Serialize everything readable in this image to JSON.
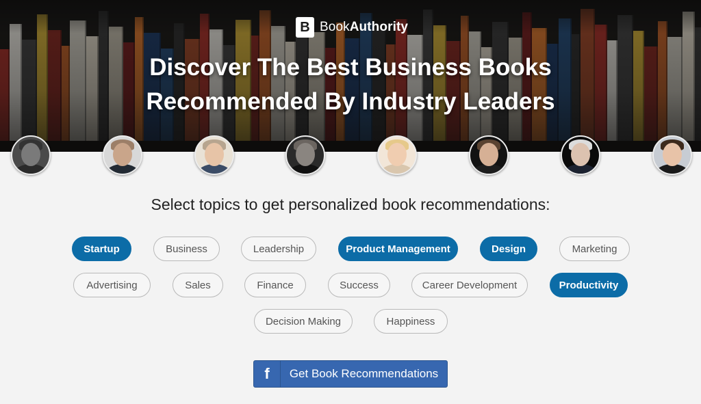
{
  "header": {
    "logo_letter": "B",
    "logo_text_prefix": "Book",
    "logo_text_suffix": "Authority",
    "headline_line1": "Discover The Best Business Books",
    "headline_line2": "Recommended By Industry Leaders"
  },
  "leaders": [
    {
      "skin": "#7a7a7a",
      "hair": "#333333",
      "shirt": "#2a2a2a",
      "bg": "#4a4a4a"
    },
    {
      "skin": "#c9a58a",
      "hair": "#9c7f68",
      "shirt": "#222a33",
      "bg": "#d8d8d8"
    },
    {
      "skin": "#e7c4a7",
      "hair": "#b7a58f",
      "shirt": "#3b4c66",
      "bg": "#e9e2d6"
    },
    {
      "skin": "#8a8580",
      "hair": "#6b6560",
      "shirt": "#111111",
      "bg": "#2a2a2a"
    },
    {
      "skin": "#f0cdb0",
      "hair": "#e6c98a",
      "shirt": "#d9c6ad",
      "bg": "#f2e6d8"
    },
    {
      "skin": "#d6b095",
      "hair": "#5a4331",
      "shirt": "#1d1d1d",
      "bg": "#121212"
    },
    {
      "skin": "#dcc2b0",
      "hair": "#dcdcdc",
      "shirt": "#1c2230",
      "bg": "#0a0a0a"
    },
    {
      "skin": "#e8c3a8",
      "hair": "#3d2a1c",
      "shirt": "#1a1a1a",
      "bg": "#c7ccd3"
    }
  ],
  "prompt": "Select topics to get personalized book recommendations:",
  "topics": [
    {
      "label": "Startup",
      "selected": true
    },
    {
      "label": "Business",
      "selected": false
    },
    {
      "label": "Leadership",
      "selected": false
    },
    {
      "label": "Product Management",
      "selected": true
    },
    {
      "label": "Design",
      "selected": true
    },
    {
      "label": "Marketing",
      "selected": false
    },
    {
      "label": "Advertising",
      "selected": false
    },
    {
      "label": "Sales",
      "selected": false
    },
    {
      "label": "Finance",
      "selected": false
    },
    {
      "label": "Success",
      "selected": false
    },
    {
      "label": "Career Development",
      "selected": false
    },
    {
      "label": "Productivity",
      "selected": true
    },
    {
      "label": "Decision Making",
      "selected": false
    },
    {
      "label": "Happiness",
      "selected": false
    }
  ],
  "cta": {
    "icon": "facebook-icon",
    "label": "Get Book Recommendations"
  },
  "colors": {
    "selected_topic": "#0c6ca7",
    "facebook_button": "#3767b0"
  }
}
